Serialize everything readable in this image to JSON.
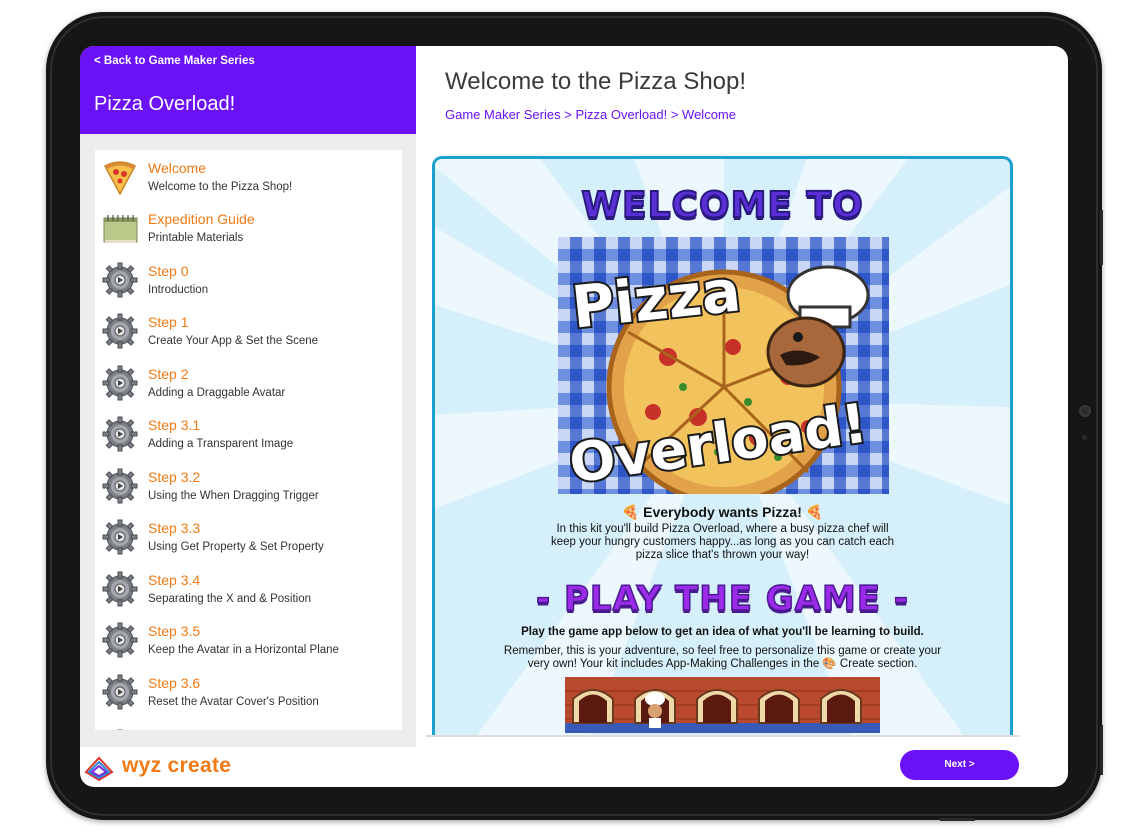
{
  "sidebar": {
    "back_label": "< Back to Game Maker Series",
    "title": "Pizza Overload!",
    "items": [
      {
        "title": "Welcome",
        "subtitle": "Welcome to the Pizza Shop!",
        "icon": "pizza-slice-icon"
      },
      {
        "title": "Expedition Guide",
        "subtitle": "Printable Materials",
        "icon": "notepad-icon"
      },
      {
        "title": "Step 0",
        "subtitle": "Introduction",
        "icon": "gear-icon"
      },
      {
        "title": "Step 1",
        "subtitle": "Create Your App & Set the Scene",
        "icon": "gear-icon"
      },
      {
        "title": "Step 2",
        "subtitle": "Adding a Draggable Avatar",
        "icon": "gear-icon"
      },
      {
        "title": "Step 3.1",
        "subtitle": "Adding a Transparent Image",
        "icon": "gear-icon"
      },
      {
        "title": "Step 3.2",
        "subtitle": "Using the When Dragging Trigger",
        "icon": "gear-icon"
      },
      {
        "title": "Step 3.3",
        "subtitle": "Using Get Property & Set Property",
        "icon": "gear-icon"
      },
      {
        "title": "Step 3.4",
        "subtitle": "Separating the X and & Position",
        "icon": "gear-icon"
      },
      {
        "title": "Step 3.5",
        "subtitle": "Keep the Avatar in a Horizontal Plane",
        "icon": "gear-icon"
      },
      {
        "title": "Step 3.6",
        "subtitle": "Reset the Avatar Cover's Position",
        "icon": "gear-icon"
      }
    ]
  },
  "main": {
    "title": "Welcome to the Pizza Shop!",
    "breadcrumb": [
      "Game Maker Series",
      "Pizza Overload!",
      "Welcome"
    ],
    "breadcrumb_sep": ">"
  },
  "content": {
    "welcome_heading": "WELCOME TO",
    "poster_line1": "Pizza",
    "poster_line2": "Overload!",
    "everybody": "Everybody wants Pizza!",
    "kit_text": "In this kit you'll build Pizza Overload, where a busy pizza chef will keep your hungry customers happy...as long as you can catch each pizza slice that's thrown your way!",
    "play_heading": "- PLAY THE GAME -",
    "play_sub": "Play the game app below to get an idea of what you'll be learning to build.",
    "adventure_text": "Remember, this is your adventure, so feel free to personalize this game or create your very own!  Your kit includes App-Making Challenges in the 🎨 Create section."
  },
  "footer": {
    "logo_text": "wyz create",
    "next_label": "Next >"
  },
  "colors": {
    "brand_purple": "#6a11f5",
    "accent_orange": "#f07a14",
    "content_border": "#1ba0cf",
    "content_bg": "#d6f0fb"
  }
}
